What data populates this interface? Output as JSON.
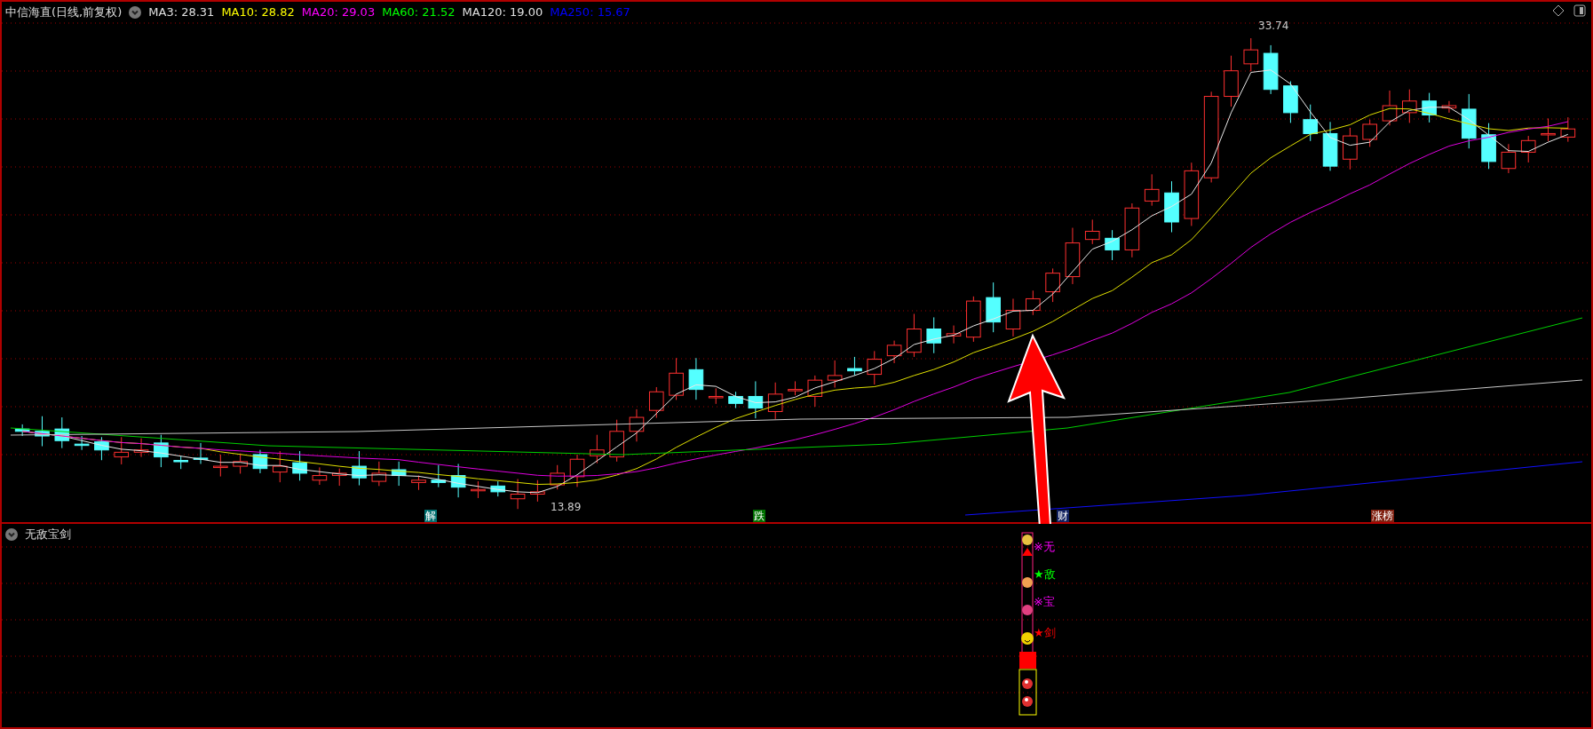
{
  "chart_header": {
    "title": "中信海直(日线,前复权)",
    "indicators": [
      {
        "label": "MA3: 28.31",
        "color": "#e0e0e0"
      },
      {
        "label": "MA10: 28.82",
        "color": "#ffff00"
      },
      {
        "label": "MA20: 29.03",
        "color": "#ff00ff"
      },
      {
        "label": "MA60: 21.52",
        "color": "#00ff00"
      },
      {
        "label": "MA120: 19.00",
        "color": "#e0e0e0"
      },
      {
        "label": "MA250: 15.67",
        "color": "#0000ff"
      }
    ]
  },
  "price_marks": {
    "high": "33.74",
    "low": "13.89"
  },
  "event_tags": [
    {
      "text": "解",
      "color": "#007070"
    },
    {
      "text": "跌",
      "color": "#007000"
    },
    {
      "text": "财",
      "color": "#102060"
    },
    {
      "text": "涨榜",
      "color": "#802010"
    }
  ],
  "indicator_panel": {
    "title": "无敌宝剑",
    "signals": [
      {
        "symbol": "※",
        "label": "无",
        "color": "#ff00ff"
      },
      {
        "symbol": "★",
        "label": "敌",
        "color": "#00ff00"
      },
      {
        "symbol": "※",
        "label": "宝",
        "color": "#ff00ff"
      },
      {
        "symbol": "★",
        "label": "剑",
        "color": "#ff0000"
      }
    ]
  }
}
